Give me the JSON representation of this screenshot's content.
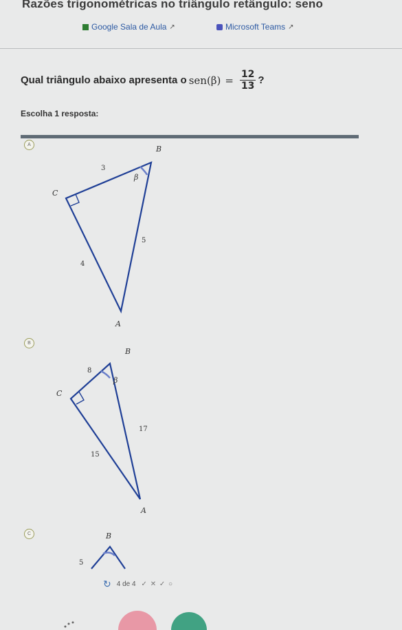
{
  "header": {
    "title": "Razões trigonométricas no triângulo retângulo: seno",
    "links": [
      {
        "label": "Google Sala de Aula",
        "icon": "google-classroom-icon"
      },
      {
        "label": "Microsoft Teams",
        "icon": "microsoft-teams-icon"
      }
    ]
  },
  "question": {
    "prefix": "Qual triângulo abaixo apresenta o",
    "func": "sen(β)",
    "equals": "=",
    "numerator": "12",
    "denominator": "13",
    "suffix": "?"
  },
  "instructions": "Escolha 1 resposta:",
  "options": [
    {
      "marker": "A",
      "vertices": {
        "b": "B",
        "c": "C",
        "a": "A"
      },
      "angle": "β",
      "sides": {
        "bc": "3",
        "ba": "5",
        "ca": "4"
      }
    },
    {
      "marker": "B",
      "vertices": {
        "b": "B",
        "c": "C",
        "a": "A"
      },
      "angle": "β",
      "sides": {
        "bc": "8",
        "ba": "17",
        "ca": "15"
      }
    },
    {
      "marker": "C",
      "vertices": {
        "b": "B"
      },
      "sides": {
        "bc": "5"
      }
    }
  ],
  "pager": {
    "text": "4 de 4",
    "status": "✓ ✕ ✓ ○"
  },
  "colors": {
    "accent_bar": "#5f6b75",
    "marker_border": "#9b9d5c",
    "link": "#2d5aa3",
    "angle_arc": "#6a7fc9"
  }
}
